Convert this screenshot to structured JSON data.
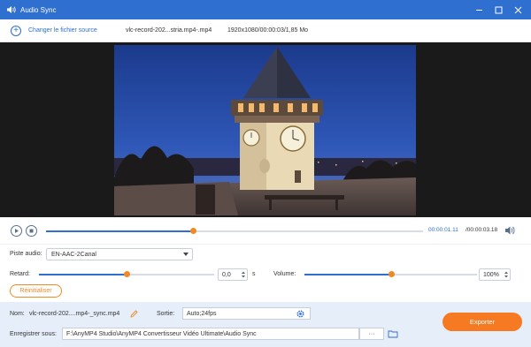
{
  "window": {
    "title": "Audio Sync"
  },
  "file_bar": {
    "change_source_label": "Changer le fichier source",
    "file_name": "vlc-record-202...stria.mp4-.mp4",
    "file_info": "1920x1080/00:00:03/1,85 Mo"
  },
  "playback": {
    "current_time": "00:00:01.11",
    "total_time": "/00:00:03.18",
    "progress": 0.39
  },
  "settings": {
    "audio_track_label": "Piste audio:",
    "audio_track_value": "EN-AAC-2Canal",
    "delay_label": "Retard:",
    "delay_value": "0,0",
    "delay_unit": "s",
    "delay_level": 0.5,
    "volume_label": "Volume:",
    "volume_value": "100%",
    "volume_level": 0.5,
    "reset_label": "Réinitialiser"
  },
  "output": {
    "name_label": "Nom:",
    "name_value": "vlc-record-202....mp4-_sync.mp4",
    "output_label": "Sortie:",
    "output_value": "Auto;24fps",
    "save_label": "Enregistrer sous:",
    "save_path": "F:\\AnyMP4 Studio\\AnyMP4 Convertisseur Vidéo Ultimate\\Audio Sync",
    "browse_label": "···",
    "export_label": "Exporter"
  },
  "colors": {
    "accent": "#2f6fcf",
    "orange": "#f08a24",
    "export": "#f57a22"
  },
  "icons": {
    "app": "speaker-icon",
    "add": "plus-circle-icon",
    "play": "play-icon",
    "stop": "stop-icon",
    "volume": "volume-icon",
    "edit": "pencil-icon",
    "settings": "gear-icon",
    "folder": "folder-icon"
  }
}
